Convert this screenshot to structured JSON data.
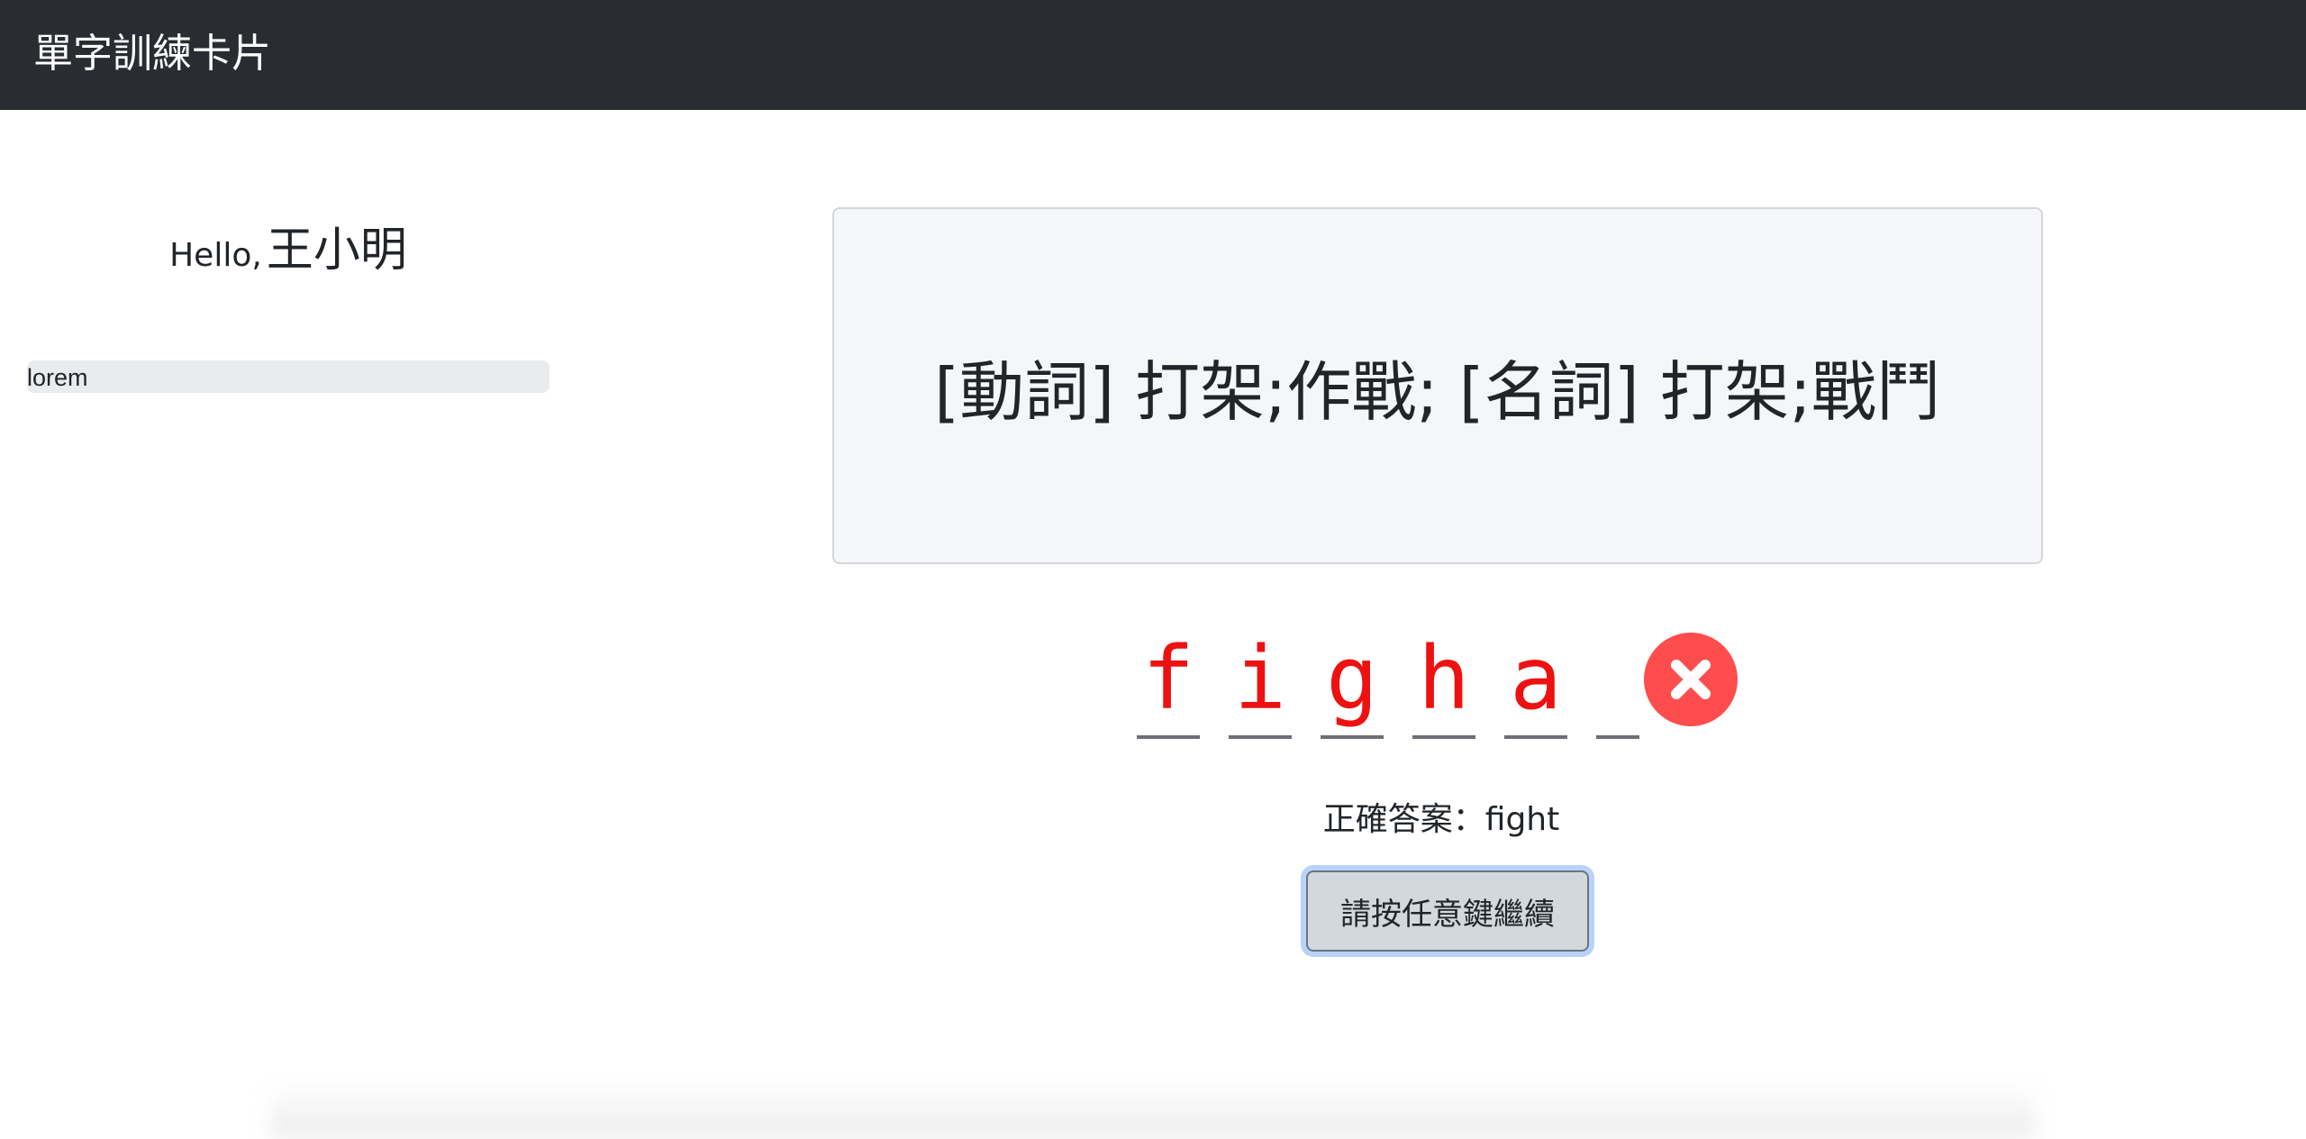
{
  "navbar": {
    "brand": "單字訓練卡片"
  },
  "sidebar": {
    "hello": "Hello,",
    "user_name": "王小明",
    "progress_label": "lorem",
    "progress_value": 0
  },
  "card": {
    "definition": "[動詞] 打架;作戰; [名詞] 打架;戰鬥"
  },
  "input": {
    "letters": [
      "f",
      "i",
      "g",
      "h",
      "a",
      ""
    ],
    "status_icon": "x-circle-icon",
    "status_color": "#ff4d4d",
    "letter_color": "#ee1111"
  },
  "result": {
    "answer_text": "正確答案：fight"
  },
  "actions": {
    "continue_label": "請按任意鍵繼續"
  }
}
